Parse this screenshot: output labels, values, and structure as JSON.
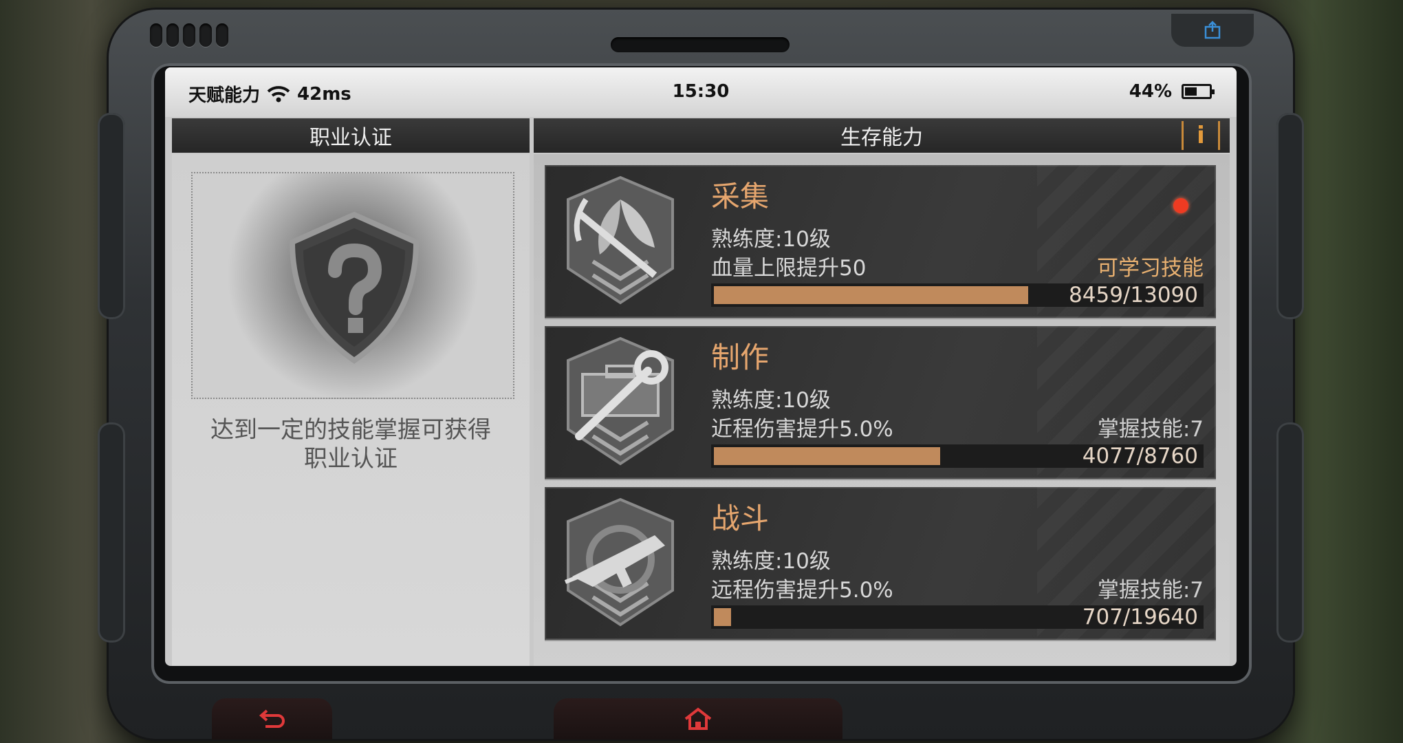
{
  "statusbar": {
    "app_label": "天赋能力",
    "ping": "42ms",
    "time": "15:30",
    "battery": "44%"
  },
  "tabs": {
    "left": "职业认证",
    "right": "生存能力",
    "info": "i"
  },
  "certification": {
    "text_line1": "达到一定的技能掌握可获得",
    "text_line2": "职业认证"
  },
  "skills": [
    {
      "title": "采集",
      "proficiency": "熟练度:10级",
      "bonus": "血量上限提升50",
      "right_label": "可学习技能",
      "progress_text": "8459/13090",
      "progress": 0.646,
      "icon": "gathering-icon",
      "has_notification": true
    },
    {
      "title": "制作",
      "proficiency": "熟练度:10级",
      "bonus": "近程伤害提升5.0%",
      "right_label": "掌握技能:7",
      "progress_text": "4077/8760",
      "progress": 0.465,
      "icon": "crafting-icon",
      "has_notification": false
    },
    {
      "title": "战斗",
      "proficiency": "熟练度:10级",
      "bonus": "远程伤害提升5.0%",
      "right_label": "掌握技能:7",
      "progress_text": "707/19640",
      "progress": 0.036,
      "icon": "combat-icon",
      "has_notification": false
    }
  ],
  "colors": {
    "accent_orange": "#e6a66e",
    "progress_fill": "#c08a5c",
    "notification_red": "#ee3b22"
  },
  "nav": {
    "back_icon": "back-arrow-icon",
    "home_icon": "home-icon"
  }
}
